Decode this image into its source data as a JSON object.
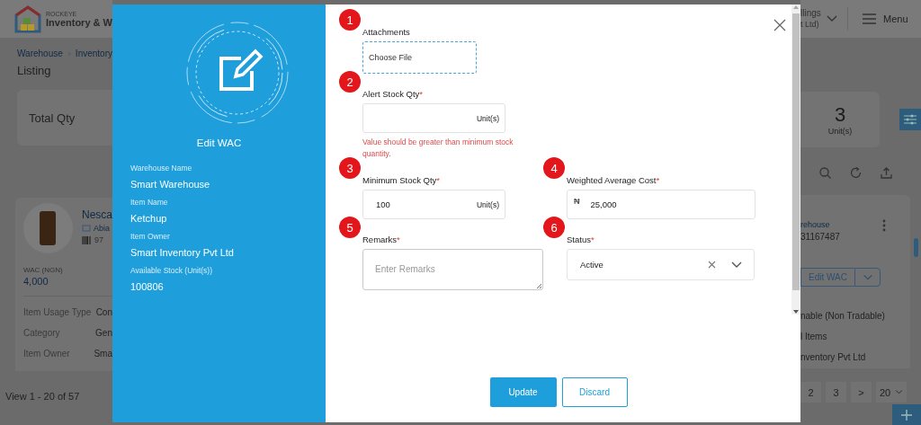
{
  "app": {
    "brand": "ROCKEYE",
    "title": "Inventory & W",
    "account": "llings",
    "account_sub": "t Ltd)",
    "menu": "Menu"
  },
  "breadcrumb": [
    {
      "label": "Warehouse"
    },
    {
      "label": "Inventory"
    }
  ],
  "page_title": "Listing",
  "summary": {
    "label": "Total Qty",
    "value": "3",
    "unit": "Unit(s)"
  },
  "item_card": {
    "name": "Nesca",
    "location": "Abia",
    "code": "97",
    "warehouse": "rehouse",
    "warehouse_code": "31167487",
    "wac_label": "WAC (NGN)",
    "wac_value": "4,000",
    "action": "Edit WAC",
    "details": [
      {
        "label": "Item Usage Type",
        "value": "Con",
        "value_end": "nable (Non Tradable)"
      },
      {
        "label": "Category",
        "value": "Gen",
        "value_end": "l Items"
      },
      {
        "label": "Item Owner",
        "value": "Sma",
        "value_end": "nventory Pvt Ltd"
      }
    ]
  },
  "pagination": {
    "summary": "View 1 - 20 of 57",
    "pages": [
      {
        "label": "2",
        "selected": false
      },
      {
        "label": "3",
        "selected": false
      }
    ],
    "next": ">",
    "page_size": "20"
  },
  "modal": {
    "title": "Edit WAC",
    "info": [
      {
        "label": "Warehouse Name",
        "value": "Smart Warehouse"
      },
      {
        "label": "Item Name",
        "value": "Ketchup"
      },
      {
        "label": "Item Owner",
        "value": "Smart Inventory Pvt Ltd"
      },
      {
        "label": "Available Stock (Unit(s))",
        "value": "100806"
      }
    ],
    "fields": [
      {
        "kind": "file",
        "marker": "1",
        "label": "Attachments",
        "value": "Choose File"
      },
      {
        "kind": "unit",
        "marker": "2",
        "label": "Alert Stock Qty",
        "required_mark": "*",
        "unit": "Unit(s)",
        "error": "Value should be greater than minimum stock quantity."
      },
      {
        "kind": "unit",
        "marker": "3",
        "label": "Minimum Stock Qty",
        "required_mark": "*",
        "value": "100",
        "unit": "Unit(s)"
      },
      {
        "kind": "currency",
        "marker": "4",
        "label": "Weighted Average Cost",
        "required_mark": "*",
        "symbol": "₦",
        "value": "25,000"
      },
      {
        "kind": "textarea",
        "marker": "5",
        "label": "Remarks",
        "required_mark": "*",
        "placeholder": "Enter Remarks"
      },
      {
        "kind": "select",
        "marker": "6",
        "label": "Status",
        "required_mark": "*",
        "value": "Active"
      }
    ],
    "buttons": [
      {
        "kind": "primary",
        "label": "Update"
      },
      {
        "kind": "secondary",
        "label": "Discard"
      }
    ]
  }
}
